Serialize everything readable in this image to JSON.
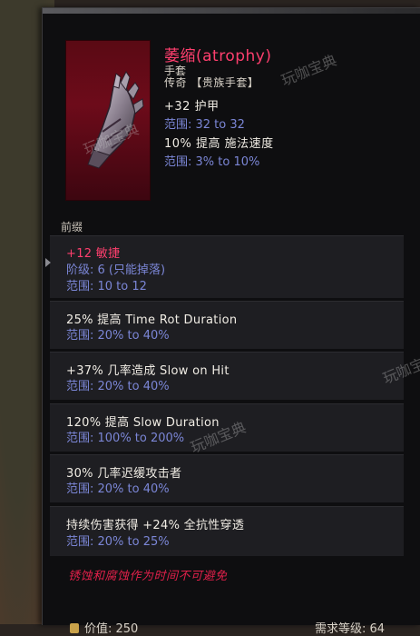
{
  "item": {
    "name": "萎缩(atrophy)",
    "type": "手套",
    "rarity": "传奇 【贵族手套】",
    "implicits": [
      {
        "text": "+32 护甲",
        "range": "范围: 32 to 32"
      },
      {
        "text": "10% 提高 施法速度",
        "range": "范围: 3% to 10%"
      }
    ]
  },
  "section_label": "前缀",
  "affixes": [
    {
      "text": "+12 敏捷",
      "tier": "阶级: 6 (只能掉落)",
      "range": "范围: 10 to 12"
    },
    {
      "text": "25% 提高 Time Rot Duration",
      "range": "范围: 20% to 40%"
    },
    {
      "text": "+37% 几率造成 Slow on Hit",
      "range": "范围: 20% to 40%"
    },
    {
      "text": "120% 提高 Slow Duration",
      "range": "范围: 100% to 200%"
    },
    {
      "text": "30% 几率迟缓攻击者",
      "range": "范围: 20% to 40%"
    },
    {
      "text": "持续伤害获得 +24% 全抗性穿透",
      "range": "范围: 20% to 25%"
    }
  ],
  "lore": "锈蚀和腐蚀作为时间不可避免",
  "footer": {
    "value": "价值: 250",
    "level_req": "需求等级: 64"
  },
  "watermark": "玩咖宝典",
  "colors": {
    "name": "#ff3f6e",
    "range": "#7b86d6",
    "lore": "#e0204a",
    "panel": "#0e0e10"
  }
}
